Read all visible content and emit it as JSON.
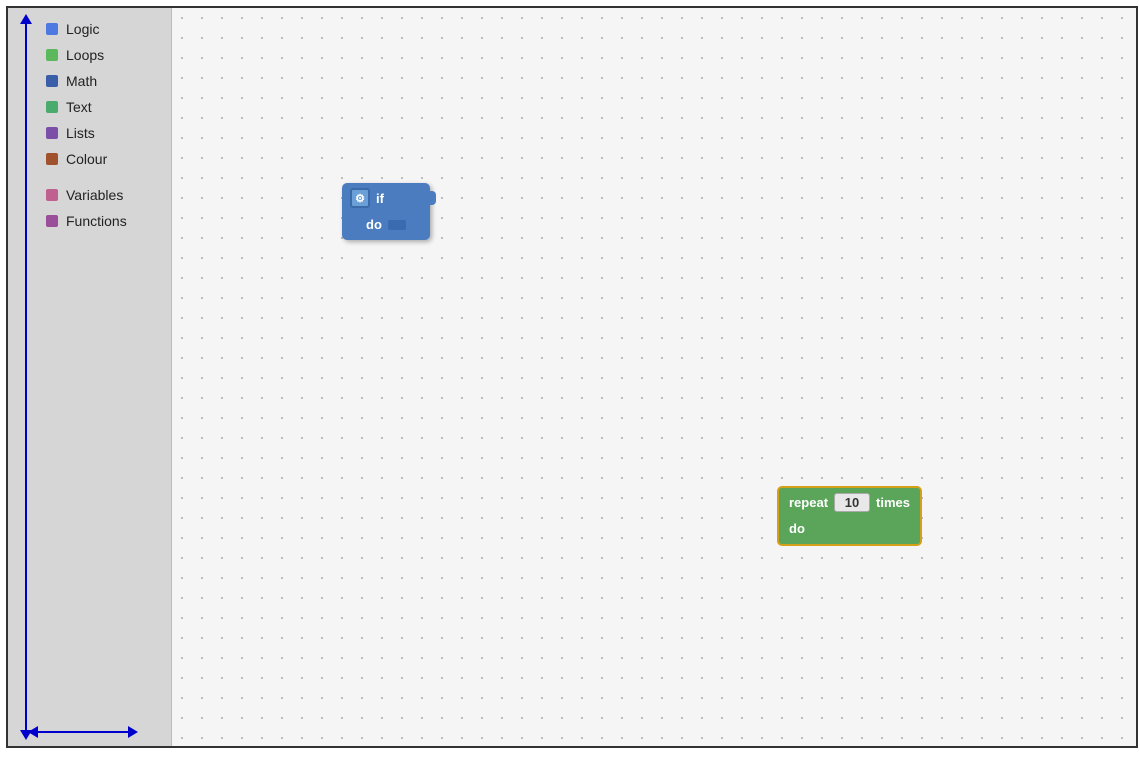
{
  "sidebar": {
    "items": [
      {
        "label": "Logic",
        "color": "#4d79e0"
      },
      {
        "label": "Loops",
        "color": "#5cb85c"
      },
      {
        "label": "Math",
        "color": "#3a5fa8"
      },
      {
        "label": "Text",
        "color": "#4aab6d"
      },
      {
        "label": "Lists",
        "color": "#7b4fa8"
      },
      {
        "label": "Colour",
        "color": "#a0522d"
      },
      {
        "label": "Variables",
        "color": "#c06090"
      },
      {
        "label": "Functions",
        "color": "#9b4f9b"
      }
    ]
  },
  "blocks": {
    "if_block": {
      "gear_icon": "⚙",
      "if_label": "if",
      "do_label": "do"
    },
    "repeat_block": {
      "repeat_label": "repeat",
      "times_label": "times",
      "number": "10",
      "do_label": "do"
    }
  },
  "colors": {
    "sidebar_bg": "#d6d6d6",
    "workspace_bg": "#f5f5f5",
    "if_block": "#4a7cbf",
    "repeat_block": "#5ba55b",
    "repeat_border": "#d4a017",
    "arrow": "#0000cc"
  }
}
